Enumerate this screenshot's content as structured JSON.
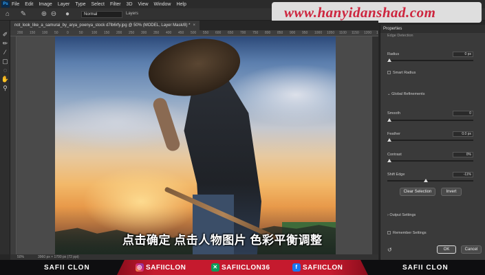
{
  "app": {
    "logo": "Ps"
  },
  "menu": [
    "File",
    "Edit",
    "Image",
    "Layer",
    "Type",
    "Select",
    "Filter",
    "3D",
    "View",
    "Window",
    "Help"
  ],
  "watermark": "www.hanyidanshad.com",
  "options": {
    "mode": "Normal",
    "layers_label": "Layers"
  },
  "document_tab": {
    "title": "not_look_like_a_samurai_by_arya_poenya_stock d7lb6rfy.jpg @ 50% (MODEL, Layer Mask/8) *",
    "close": "×"
  },
  "ruler_ticks": [
    "200",
    "150",
    "100",
    "50",
    "0",
    "50",
    "100",
    "150",
    "200",
    "250",
    "300",
    "350",
    "400",
    "450",
    "500",
    "550",
    "600",
    "650",
    "700",
    "750",
    "800",
    "850",
    "900",
    "950",
    "1000",
    "1050",
    "1100",
    "1150",
    "1200",
    "1250"
  ],
  "subtitle": "点击确定 点击人物图片 色彩平衡调整",
  "status": {
    "zoom": "50%",
    "doc_size": "3960 px × 1700 px (72 ppi)"
  },
  "properties": {
    "title": "Properties",
    "edge_detection": "Edge Detection",
    "radius_label": "Radius",
    "radius_value": "0 px",
    "smart_radius": "Smart Radius",
    "global_refinements": "Global Refinements",
    "smooth_label": "Smooth",
    "smooth_value": "0",
    "feather_label": "Feather",
    "feather_value": "0.0 px",
    "contrast_label": "Contrast",
    "contrast_value": "0%",
    "shift_edge_label": "Shift Edge",
    "shift_edge_value": "-11%",
    "clear_selection": "Clear Selection",
    "invert": "Invert",
    "output_settings": "Output Settings",
    "remember_settings": "Remember Settings",
    "ok": "OK",
    "cancel": "Cancel"
  },
  "footer": {
    "left": "SAFII CLON",
    "instagram": "SAFIICLON",
    "xing": "SAFIICLON36",
    "facebook": "SAFIICLON",
    "right": "SAFII CLON"
  }
}
